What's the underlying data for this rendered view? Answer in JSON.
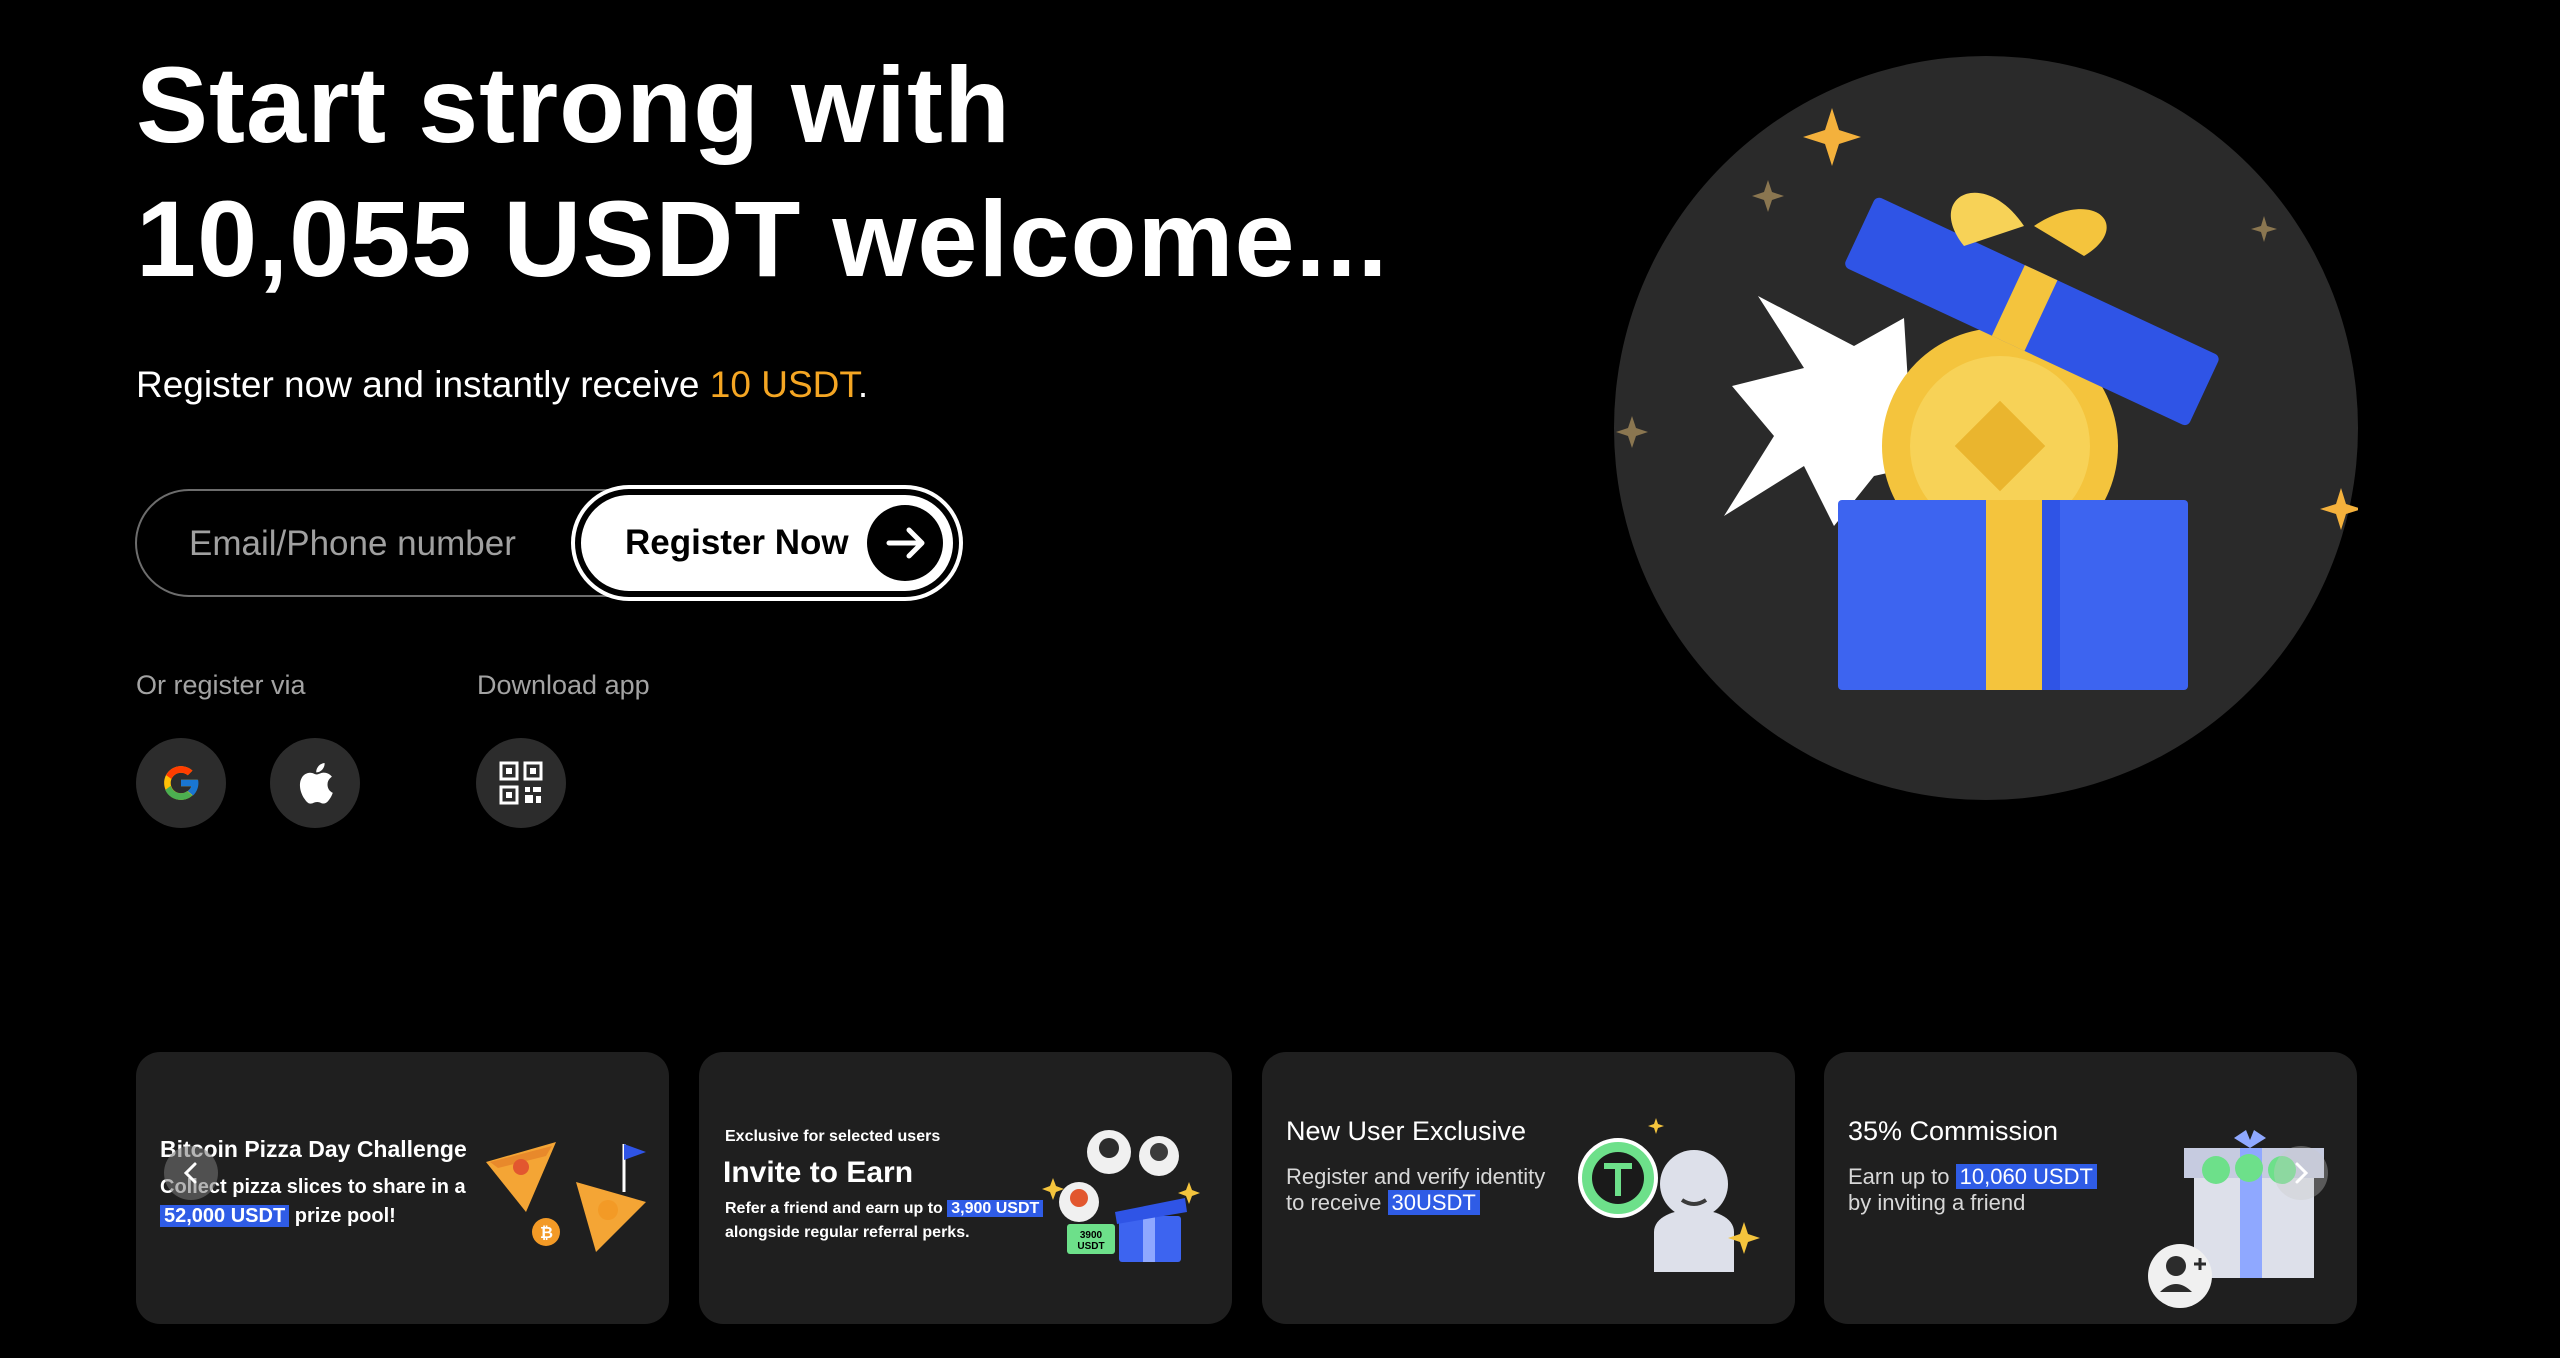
{
  "hero": {
    "title_line1": "Start strong with",
    "title_line2": "10,055 USDT welcome...",
    "subtitle_prefix": "Register now and instantly receive ",
    "subtitle_highlight": "10 USDT",
    "subtitle_suffix": "."
  },
  "form": {
    "placeholder": "Email/Phone number",
    "button_label": "Register Now"
  },
  "social": {
    "register_label": "Or register via",
    "download_label": "Download app",
    "buttons": [
      "google-icon",
      "apple-icon",
      "qr-code-icon"
    ]
  },
  "cards": [
    {
      "title": "Bitcoin Pizza Day Challenge",
      "body_line1": "Collect pizza slices to share in a",
      "body_highlight": "52,000 USDT",
      "body_line2_suffix": " prize pool!"
    },
    {
      "eyebrow": "Exclusive for selected users",
      "title": "Invite to Earn",
      "body_prefix": "Refer a friend and earn up to ",
      "body_highlight": "3,900 USDT",
      "body_line2": "alongside regular referral perks.",
      "gift_label_line1": "3900",
      "gift_label_line2": "USDT"
    },
    {
      "title": "New User Exclusive",
      "body_line1": "Register and verify identity",
      "body_prefix": "to receive ",
      "body_highlight": "30USDT"
    },
    {
      "title": "35% Commission",
      "body_prefix": "Earn up to ",
      "body_highlight": "10,060 USDT",
      "body_line2": "by inviting a friend"
    }
  ],
  "colors": {
    "background": "#000000",
    "accent_orange": "#f5a623",
    "highlight_blue": "#2f5ce6",
    "card_bg": "#1f1f1f",
    "icon_circle_bg": "#2c2c2c"
  }
}
